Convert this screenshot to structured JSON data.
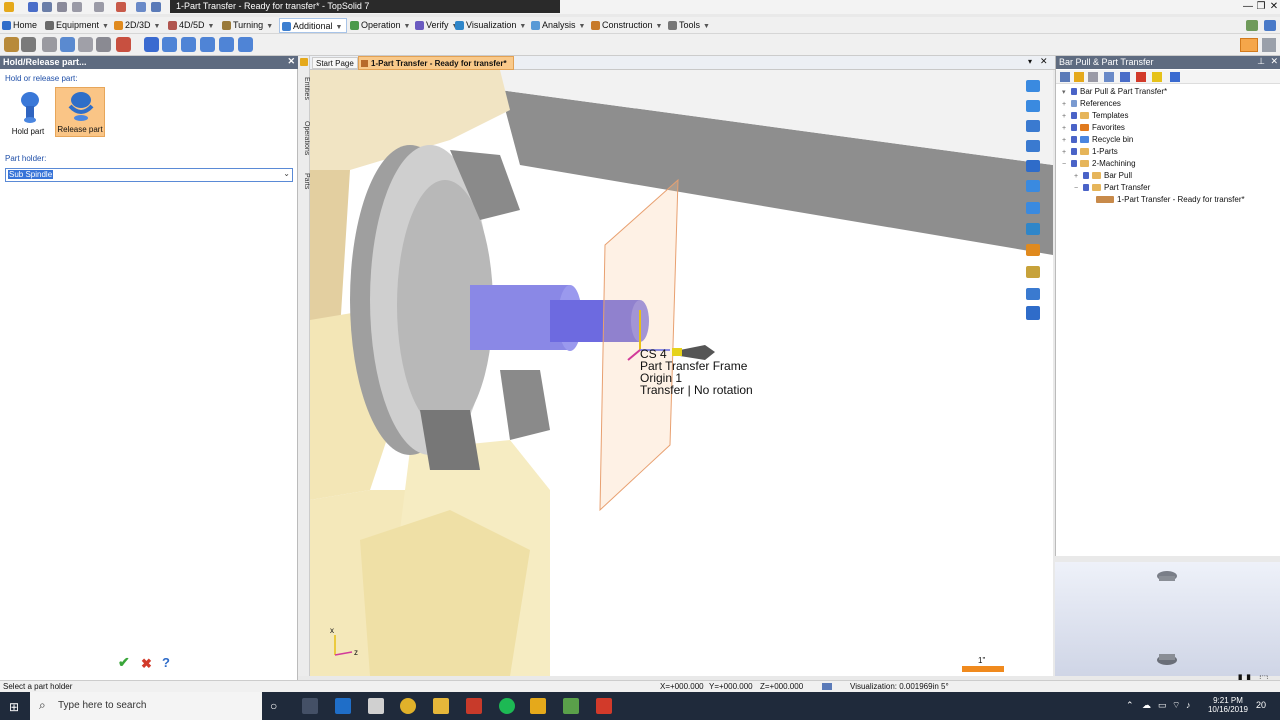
{
  "window": {
    "title": "1-Part Transfer - Ready for transfer* - TopSolid 7"
  },
  "menubar": {
    "items": [
      {
        "label": "Home",
        "color": "#2f6cc9"
      },
      {
        "label": "Equipment",
        "color": "#6a6a6a"
      },
      {
        "label": "2D/3D",
        "color": "#e08a1e"
      },
      {
        "label": "4D/5D",
        "color": "#b0554f"
      },
      {
        "label": "Turning",
        "color": "#9a7a3a"
      },
      {
        "label": "Additional",
        "color": "#3d7fd0"
      },
      {
        "label": "Operation",
        "color": "#4a9a4a"
      },
      {
        "label": "Verify",
        "color": "#6a5ac0"
      },
      {
        "label": "Visualization",
        "color": "#2f86c9"
      },
      {
        "label": "Analysis",
        "color": "#5a9ad6"
      },
      {
        "label": "Construction",
        "color": "#c77a2a"
      },
      {
        "label": "Tools",
        "color": "#777777"
      }
    ]
  },
  "left_panel": {
    "header": "Hold/Release part...",
    "section_label": "Hold or release part:",
    "hold_label": "Hold part",
    "release_label": "Release part",
    "part_holder_label": "Part holder:",
    "part_holder_value": "Sub Spindle"
  },
  "side_tabs": [
    "Entities",
    "Operations",
    "Parts"
  ],
  "doc_tabs": {
    "start": "Start Page",
    "active": "1-Part Transfer - Ready for transfer*"
  },
  "viewport": {
    "annotation": [
      "CS 4",
      "Part Transfer Frame",
      "Origin 1",
      "Transfer | No rotation"
    ],
    "scale_label": "1\"",
    "axis_x": "x",
    "axis_z": "z"
  },
  "right_panel": {
    "header": "Bar Pull & Part Transfer",
    "tree": [
      {
        "label": "Bar Pull & Part Transfer*",
        "level": 0,
        "exp": "▾"
      },
      {
        "label": "References",
        "level": 1,
        "exp": "+"
      },
      {
        "label": "Templates",
        "level": 1,
        "exp": "+"
      },
      {
        "label": "Favorites",
        "level": 1,
        "exp": "+"
      },
      {
        "label": "Recycle bin",
        "level": 1,
        "exp": "+"
      },
      {
        "label": "1-Parts",
        "level": 1,
        "exp": "+"
      },
      {
        "label": "2-Machining",
        "level": 1,
        "exp": "−"
      },
      {
        "label": "Bar Pull",
        "level": 2,
        "exp": "+"
      },
      {
        "label": "Part Transfer",
        "level": 2,
        "exp": "−"
      },
      {
        "label": "1-Part Transfer - Ready for transfer*",
        "level": 3,
        "exp": ""
      }
    ]
  },
  "statusbar": {
    "hint": "Select a part holder",
    "x": "X=+000.000",
    "y": "Y=+000.000",
    "z": "Z=+000.000",
    "visualization": "Visualization: 0.001969in 5°"
  },
  "taskbar": {
    "search_placeholder": "Type here to search",
    "time": "9:21 PM",
    "date": "10/16/2019",
    "notif_count": "20"
  }
}
